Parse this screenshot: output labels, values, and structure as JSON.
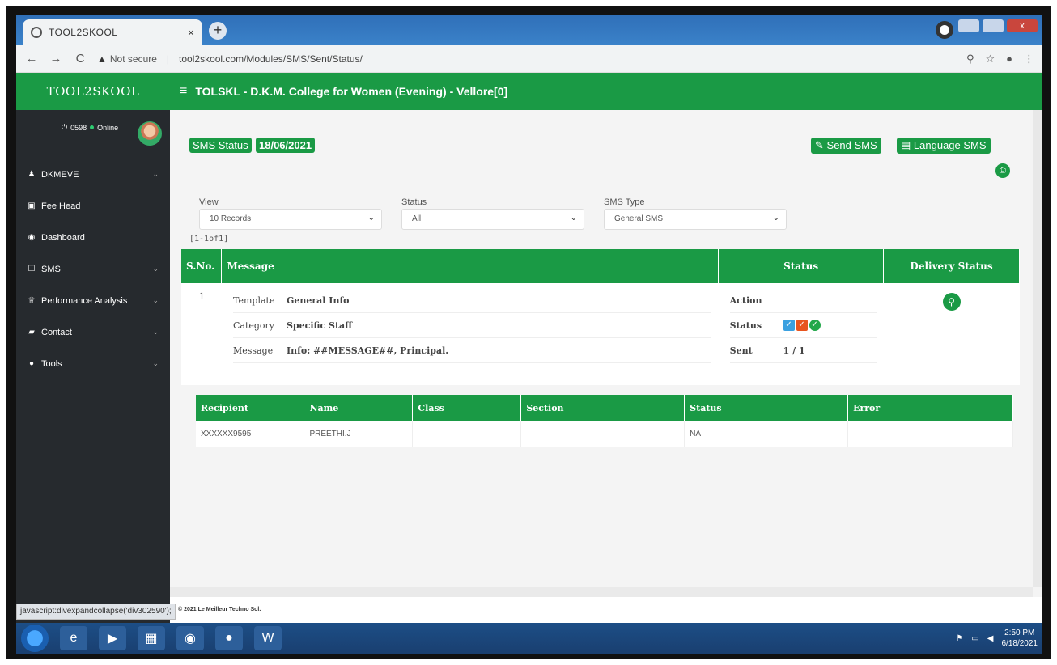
{
  "browser": {
    "tab_title": "TOOL2SKOOL",
    "tab_close": "×",
    "new_tab": "+",
    "security": "Not secure",
    "url": "tool2skool.com/Modules/SMS/Sent/Status/"
  },
  "sidebar": {
    "brand": "TOOL2SKOOL",
    "user_status": "0598",
    "online": "Online",
    "items": [
      {
        "label": "DKMEVE",
        "icon": "user-icon",
        "has_children": true
      },
      {
        "label": "Fee Head",
        "icon": "edit-icon",
        "has_children": false
      },
      {
        "label": "Dashboard",
        "icon": "dashboard-icon",
        "has_children": false
      },
      {
        "label": "SMS",
        "icon": "sms-icon",
        "has_children": true
      },
      {
        "label": "Performance Analysis",
        "icon": "trophy-icon",
        "has_children": true
      },
      {
        "label": "Contact",
        "icon": "book-icon",
        "has_children": true
      },
      {
        "label": "Tools",
        "icon": "circle-icon",
        "has_children": true
      }
    ]
  },
  "header": {
    "title": "TOLSKL - D.K.M. College for Women (Evening) - Vellore[0]"
  },
  "page": {
    "sms_status_label": "SMS Status",
    "date": "18/06/2021",
    "send_sms": "Send SMS",
    "language_sms": "Language SMS"
  },
  "filters": {
    "view_label": "View",
    "view_value": "10 Records",
    "status_label": "Status",
    "status_value": "All",
    "type_label": "SMS Type",
    "type_value": "General SMS",
    "records_info": "[1-1of1]"
  },
  "message_table": {
    "columns": [
      "S.No.",
      "Message",
      "Status",
      "Delivery Status"
    ],
    "row": {
      "sno": "1",
      "template_label": "Template",
      "template": "General Info",
      "category_label": "Category",
      "category": "Specific Staff",
      "message_label": "Message",
      "message": "Info: ##MESSAGE##, Principal.",
      "action_label": "Action",
      "status_label": "Status",
      "sent_label": "Sent",
      "sent": "1 / 1"
    }
  },
  "recipient_table": {
    "columns": [
      "Recipient",
      "Name",
      "Class",
      "Section",
      "Status",
      "Error"
    ],
    "rows": [
      {
        "recipient": "XXXXXX9595",
        "name": "PREETHI.J",
        "class": "",
        "section": "",
        "status": "NA",
        "error": ""
      }
    ]
  },
  "footer": {
    "copyright": "© 2021 Le Meilleur Techno Sol."
  },
  "statusbar": {
    "link": "javascript:divexpandcollapse('div302590');"
  },
  "taskbar": {
    "time": "2:50 PM",
    "date": "6/18/2021"
  },
  "colors": {
    "brand_green": "#1a9a45",
    "sidebar_bg": "#262a2e"
  }
}
